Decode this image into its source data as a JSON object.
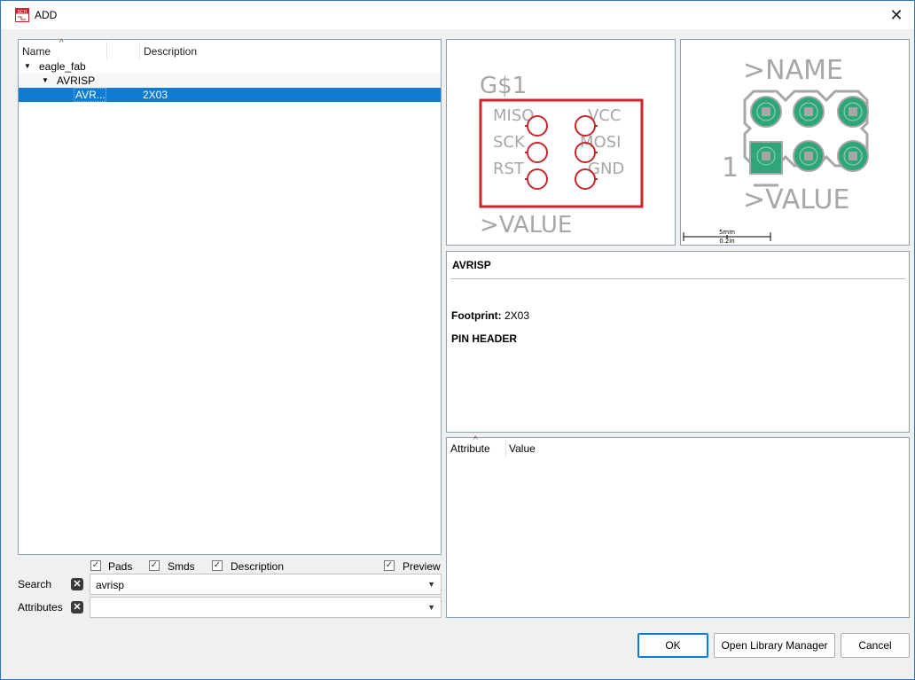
{
  "window": {
    "title": "ADD",
    "close_glyph": "✕",
    "icon_text": "SCH"
  },
  "tree": {
    "columns": [
      "Name",
      "Description"
    ],
    "rows": [
      {
        "name": "eagle_fab",
        "description": "",
        "level": 0,
        "expanded": true
      },
      {
        "name": "AVRISP",
        "description": "",
        "level": 1,
        "expanded": true
      },
      {
        "name": "AVR...",
        "description": "2X03",
        "level": 2,
        "selected": true
      }
    ],
    "expand_glyph": "▼",
    "sort_glyph": "^"
  },
  "symbol_preview": {
    "name": "G$1",
    "value": ">VALUE",
    "pins_left": [
      "MISO",
      "SCK",
      "RST"
    ],
    "pins_right": [
      "VCC",
      "MOSI",
      "GND"
    ]
  },
  "package_preview": {
    "name": ">NAME",
    "value": ">VALUE",
    "pin1_label": "1",
    "scale_top": "5mm",
    "scale_bottom": "0.2in"
  },
  "description": {
    "title": "AVRISP",
    "footprint_label": "Footprint:",
    "footprint_value": "2X03",
    "text": "PIN HEADER"
  },
  "attributes": {
    "columns": [
      "Attribute",
      "Value"
    ],
    "sort_glyph": "^"
  },
  "filters": {
    "pads": {
      "label": "Pads",
      "checked": true
    },
    "smds": {
      "label": "Smds",
      "checked": true
    },
    "description": {
      "label": "Description",
      "checked": true
    },
    "preview": {
      "label": "Preview",
      "checked": true
    },
    "check_glyph": "✓"
  },
  "search": {
    "label": "Search",
    "value": "avrisp",
    "clear_glyph": "✕",
    "arrow": "▼"
  },
  "attributes_filter": {
    "label": "Attributes",
    "value": "",
    "clear_glyph": "✕",
    "arrow": "▼"
  },
  "buttons": {
    "ok": "OK",
    "library_manager": "Open Library Manager",
    "cancel": "Cancel"
  },
  "colors": {
    "accent": "#0e7cd3",
    "symbol_red": "#c7262c",
    "pad_green": "#2fa57a",
    "pad_grey": "#a7a7a7"
  }
}
